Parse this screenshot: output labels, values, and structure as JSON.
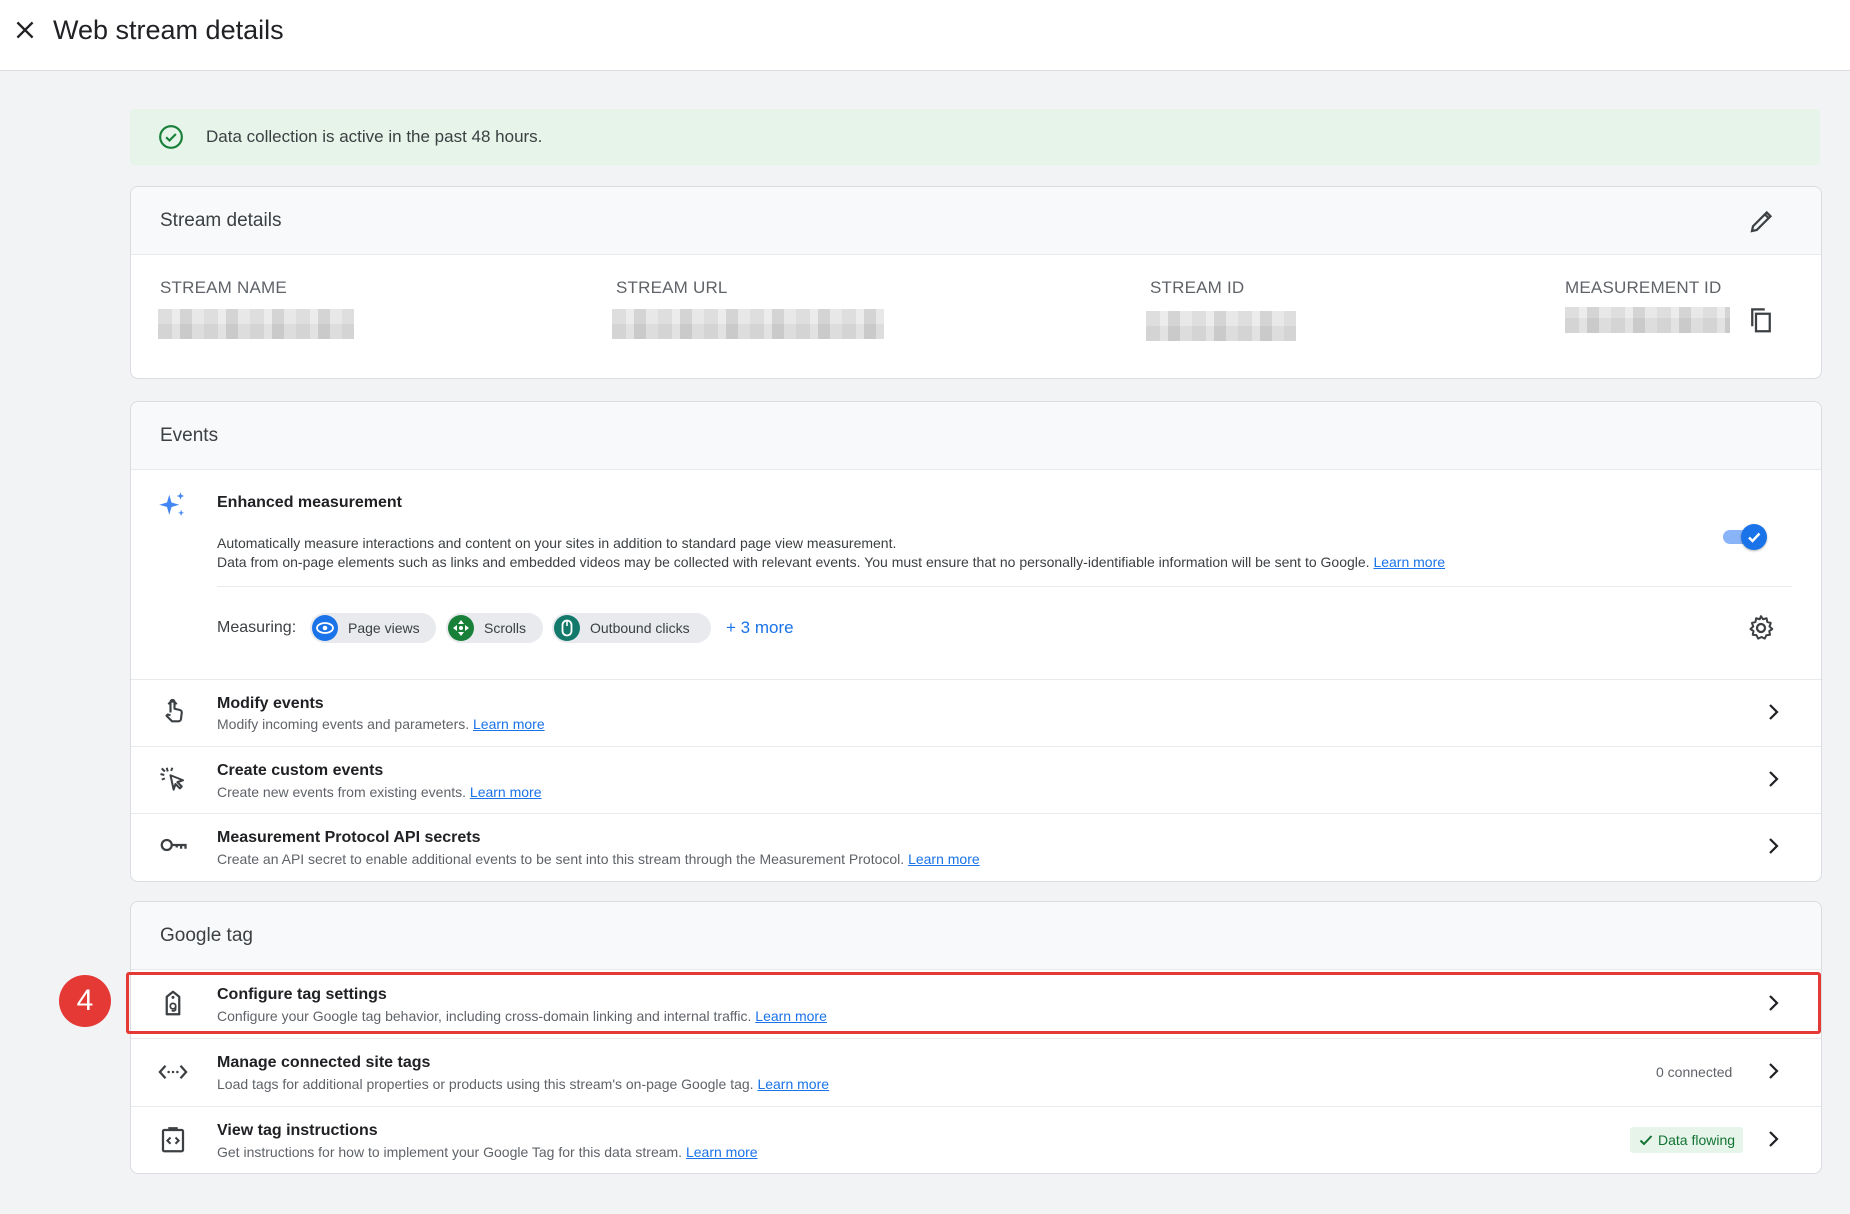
{
  "header": {
    "title": "Web stream details",
    "close_icon": "close-icon"
  },
  "alert": {
    "text": "Data collection is active in the past 48 hours.",
    "icon": "check-circle-icon",
    "color": "#188038"
  },
  "stream_details": {
    "title": "Stream details",
    "fields": {
      "stream_name": "STREAM NAME",
      "stream_url": "STREAM URL",
      "stream_id": "STREAM ID",
      "measurement_id": "MEASUREMENT ID"
    }
  },
  "events": {
    "title": "Events",
    "enhanced": {
      "title": "Enhanced measurement",
      "desc1": "Automatically measure interactions and content on your sites in addition to standard page view measurement.",
      "desc2": "Data from on-page elements such as links and embedded videos may be collected with relevant events. You must ensure that no personally-identifiable information will be sent to Google.",
      "learn_more": "Learn more",
      "enabled": true
    },
    "measuring_label": "Measuring:",
    "chips": [
      "Page views",
      "Scrolls",
      "Outbound clicks"
    ],
    "more": "+ 3 more",
    "rows": [
      {
        "title": "Modify events",
        "desc": "Modify incoming events and parameters.",
        "link": "Learn more"
      },
      {
        "title": "Create custom events",
        "desc": "Create new events from existing events.",
        "link": "Learn more"
      },
      {
        "title": "Measurement Protocol API secrets",
        "desc": "Create an API secret to enable additional events to be sent into this stream through the Measurement Protocol.",
        "link": "Learn more"
      }
    ]
  },
  "google_tag": {
    "title": "Google tag",
    "rows": [
      {
        "title": "Configure tag settings",
        "desc": "Configure your Google tag behavior, including cross-domain linking and internal traffic.",
        "link": "Learn more"
      },
      {
        "title": "Manage connected site tags",
        "desc": "Load tags for additional properties or products using this stream's on-page Google tag.",
        "link": "Learn more",
        "badge": "0 connected"
      },
      {
        "title": "View tag instructions",
        "desc": "Get instructions for how to implement your Google Tag for this data stream.",
        "link": "Learn more",
        "badge": "Data flowing"
      }
    ]
  },
  "annotation": {
    "step": "4",
    "color": "#e53935"
  }
}
